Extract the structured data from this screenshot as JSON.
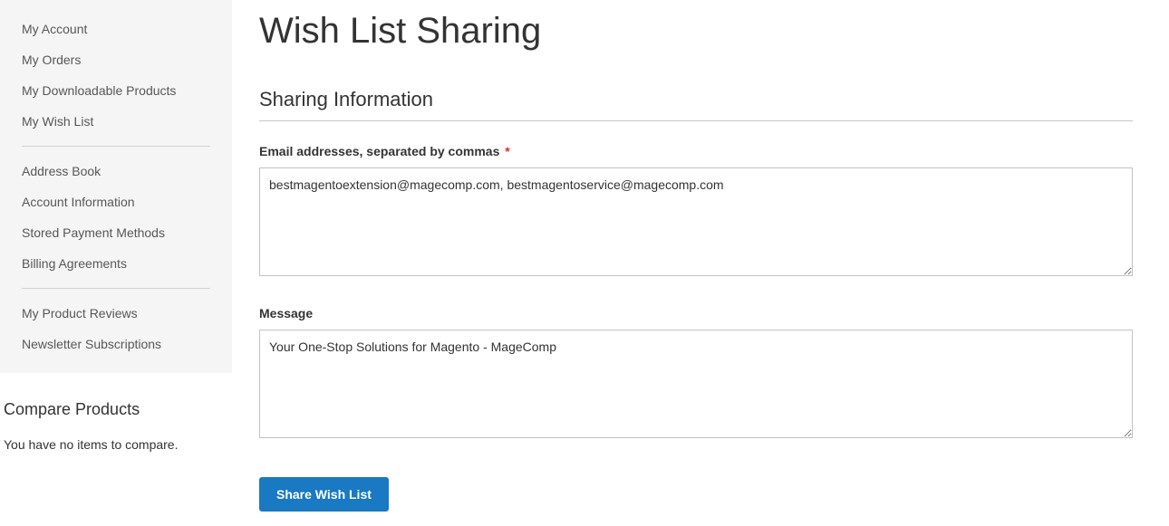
{
  "sidebar": {
    "group1": [
      {
        "label": "My Account"
      },
      {
        "label": "My Orders"
      },
      {
        "label": "My Downloadable Products"
      },
      {
        "label": "My Wish List"
      }
    ],
    "group2": [
      {
        "label": "Address Book"
      },
      {
        "label": "Account Information"
      },
      {
        "label": "Stored Payment Methods"
      },
      {
        "label": "Billing Agreements"
      }
    ],
    "group3": [
      {
        "label": "My Product Reviews"
      },
      {
        "label": "Newsletter Subscriptions"
      }
    ]
  },
  "compare": {
    "title": "Compare Products",
    "empty_text": "You have no items to compare."
  },
  "page": {
    "title": "Wish List Sharing"
  },
  "form": {
    "section_title": "Sharing Information",
    "email_label": "Email addresses, separated by commas",
    "email_value": "bestmagentoextension@magecomp.com, bestmagentoservice@magecomp.com",
    "message_label": "Message",
    "message_value": "Your One-Stop Solutions for Magento - MageComp",
    "submit_label": "Share Wish List",
    "required_mark": "*"
  }
}
